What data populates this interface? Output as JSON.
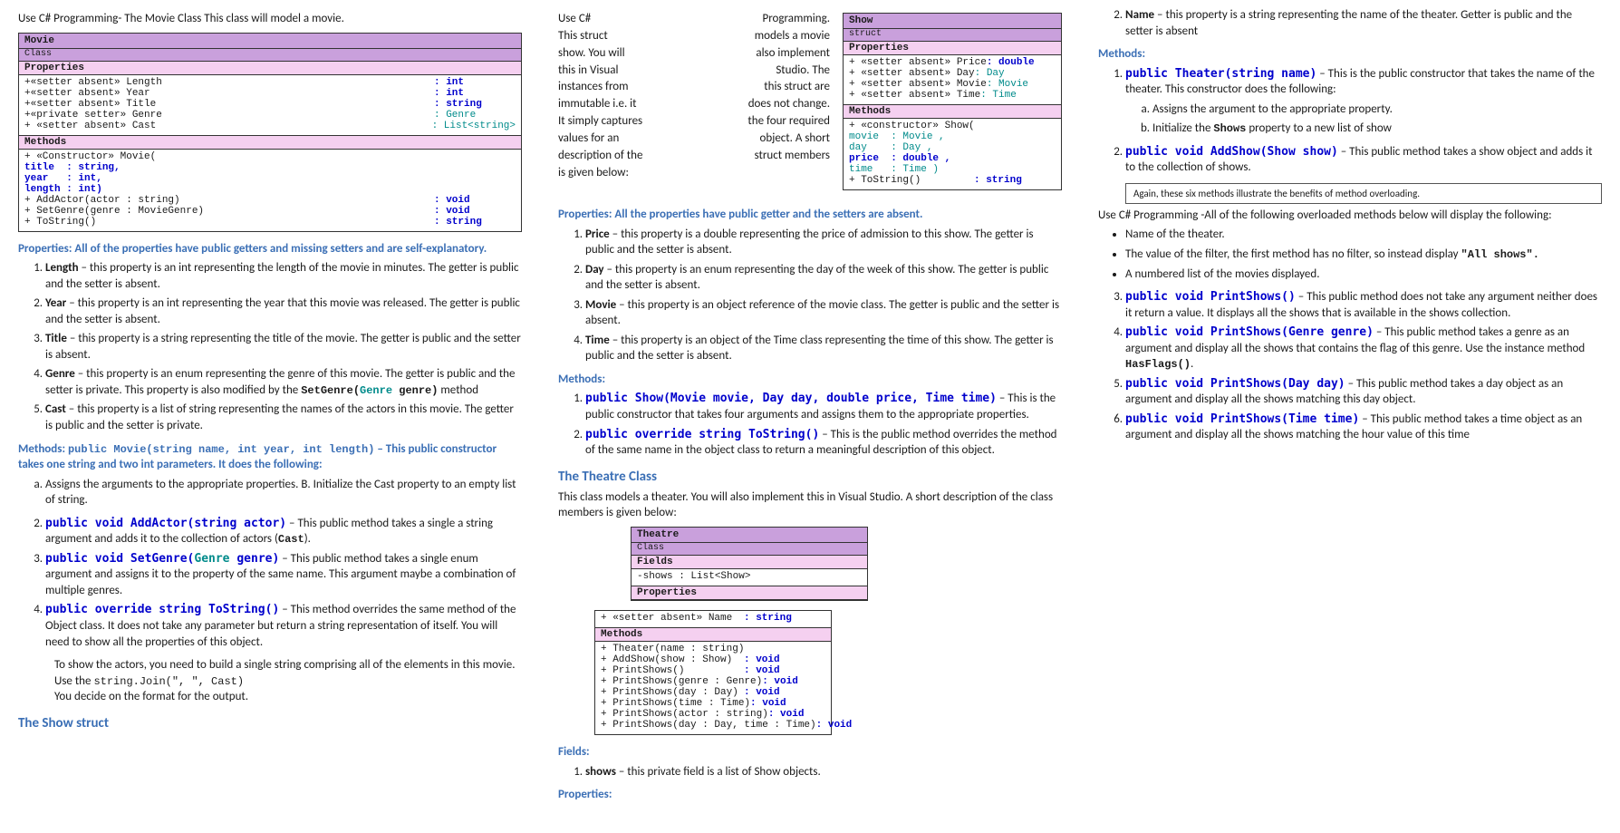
{
  "intro": "Use C# Programming- The Movie Class This class will model a movie.",
  "movie_uml": {
    "name": "Movie",
    "kind": "Class",
    "props": [
      {
        "l": "+«setter absent» Length",
        "r": ": int"
      },
      {
        "l": "+«setter absent» Year",
        "r": ": int"
      },
      {
        "l": "+«setter absent» Title",
        "r": ": string"
      },
      {
        "l": "+«private setter» Genre",
        "r": ": Genre"
      },
      {
        "l": "+ «setter absent» Cast",
        "r": "  : List<string>"
      }
    ],
    "methods": {
      "ctor_label": "+ «Constructor» Movie(",
      "ctor_args": [
        "title  : string,",
        "year   : int,",
        "length : int)"
      ],
      "rows": [
        {
          "l": "+ AddActor(actor : string)",
          "r": ": void"
        },
        {
          "l": "+ SetGenre(genre : MovieGenre)",
          "r": ": void"
        },
        {
          "l": "+ ToString()",
          "r": ": string"
        }
      ]
    }
  },
  "props_head": "Properties: All of the properties have public getters and missing setters and are self-explanatory.",
  "props_list": [
    {
      "name": "Length",
      "desc": " – this property is an int representing the length of the movie in minutes. The getter is public and the setter is absent."
    },
    {
      "name": "Year",
      "desc": " – this property is an int representing the year that this movie was released. The getter is public and the setter is absent."
    },
    {
      "name": "Title",
      "desc": " – this property is a string representing the title of the movie. The getter is public and the setter is absent."
    },
    {
      "name": "Genre",
      "desc": " – this property is an enum representing the genre of this movie. The getter is public and the setter is private. This property is also modified by the ",
      "tail": " method"
    },
    {
      "name": "Cast",
      "desc": " – this property is a list of string representing the names of the actors in this movie. The getter is public and the setter is private."
    }
  ],
  "genre_sig_pre": "SetGenre(",
  "genre_sig_type": "Genre",
  "genre_sig_post": " genre)",
  "methods_head_pre": "Methods: ",
  "methods_sig": "public Movie(string name, int year, int length)",
  "methods_head_post": " – This public constructor takes one string and two int  parameters. It does the following:",
  "methods_list": {
    "a": "Assigns the arguments to the appropriate properties. B. Initialize the Cast property to an empty list of string.",
    "addactor_sig": "public void AddActor(string actor)",
    "addactor_desc": " – This public method takes a single a string argument and adds it to the collection of actors (",
    "addactor_cast": "Cast",
    "addactor_end": ").",
    "setgenre_sig_pre": "public void SetGenre(",
    "setgenre_sig_type": "Genre",
    "setgenre_sig_post": " genre)",
    "setgenre_desc": " – This public method takes a single enum argument and assigns it to the property of the same name. This argument maybe a combination of multiple genres.",
    "tostring_sig": "public override string ToString()",
    "tostring_desc": " – This method overrides the same method of the Object class. It does not take any parameter but return a string representation of itself. You will need to show all the properties of this object."
  },
  "col2_top": {
    "p1": "To show the actors, you need to build a single string comprising all of the elements in this movie. Use the ",
    "code": "string.Join(\", \", Cast)",
    "p2": "You decide on the format for the output."
  },
  "show_head": "The Show struct",
  "show_text": {
    "l1": "Use C#",
    "l2": "This struct",
    "l3": "show. You will",
    "l4": "this in Visual",
    "l5": "instances from",
    "l6": "immutable i.e. it",
    "l7": "It simply captures",
    "l8": "values for an",
    "l9": "description of the",
    "l10": "is given below:",
    "r1": "Programming.",
    "r2": "models a movie",
    "r3": "also implement",
    "r4": "Studio. The",
    "r5": "this struct are",
    "r6": "does not change.",
    "r7": "the four required",
    "r8": "object. A short",
    "r9": "struct members"
  },
  "show_uml": {
    "name": "Show",
    "kind": "struct",
    "props": [
      {
        "l": "+ «setter absent» Price",
        "r": ": double"
      },
      {
        "l": "+ «setter absent» Day",
        "r": ": Day"
      },
      {
        "l": "+ «setter absent» Movie",
        "r": ": Movie"
      },
      {
        "l": "+ «setter absent» Time",
        "r": ": Time"
      }
    ],
    "ctor_label": "+ «constructor» Show(",
    "ctor_args": [
      "movie  : Movie ,",
      "day    : Day ,",
      "price  : double ,",
      "time   : Time )"
    ],
    "ts": {
      "l": "+ ToString()",
      "r": ": string"
    }
  },
  "show_props_head": "Properties: All the properties have public getter and the setters are absent.",
  "show_props": [
    {
      "name": "Price",
      "desc": " – this property is a double representing the price of admission to this show. The getter is public and the setter is absent."
    },
    {
      "name": "Day",
      "desc": " – this property is an enum representing the day of the week of this show. The getter is public and the setter is absent."
    },
    {
      "name": "Movie",
      "desc": " – this property is an object reference of the movie class. The getter is public and the setter is absent."
    },
    {
      "name": "Time",
      "desc": " – this property is an object of the Time class representing the time of this show. The getter is public and the setter is absent."
    }
  ],
  "show_methods_head": "Methods:",
  "show_m1_sig": "public Show(Movie movie, Day day, double price, Time time)",
  "show_m1_desc": " – This is the public constructor that takes four arguments and assigns them to the appropriate properties.",
  "show_m2_sig": "public override string ToString()",
  "show_m2_desc": " – This is the public method overrides the method of the same name in the object class to return a meaningful description of this object.",
  "theatre_head": "The Theatre Class",
  "theatre_intro": "This class models a theater. You will also implement this in Visual Studio. A short description of the class members is given below:",
  "theatre_uml": {
    "name": "Theatre",
    "kind": "Class",
    "fields": [
      {
        "l": "-shows : List<Show>",
        "r": ""
      }
    ],
    "prop_top": {
      "l": "+ «setter absent» Name",
      "r": ": string"
    },
    "methods": [
      {
        "l": "+ Theater(name : string)",
        "r": ""
      },
      {
        "l": "+ AddShow(show : Show)",
        "r": ": void"
      },
      {
        "l": "+ PrintShows()",
        "r": ": void"
      },
      {
        "l": "+ PrintShows(genre : Genre)",
        "r": ": void"
      },
      {
        "l": "+ PrintShows(day : Day)",
        "r": ": void"
      },
      {
        "l": "+ PrintShows(time : Time)",
        "r": ": void"
      },
      {
        "l": "+ PrintShows(actor : string)",
        "r": ": void"
      },
      {
        "l": "+ PrintShows(day : Day, time : Time)",
        "r": ": void"
      }
    ]
  },
  "fields_head": "Fields:",
  "fields_item_name": "shows",
  "fields_item_desc": " – this private field is a list of Show objects.",
  "props3_head": "Properties:",
  "props3_name": "Name",
  "props3_desc": " – this property is a string representing the name of the theater. Getter is public and the setter is absent",
  "methods3_head": "Methods:",
  "t_m1_sig": "public Theater(string name)",
  "t_m1_desc": " – This is the public constructor that takes the name of the theater. This constructor does the following:",
  "t_m1_a": "Assigns the argument to the appropriate property.",
  "t_m1_b_pre": "Initialize the ",
  "t_m1_b_code": "Shows",
  "t_m1_b_post": " property to a new list of show",
  "t_m2_sig": "public void AddShow(Show show)",
  "t_m2_desc": " – This public method takes a show object and adds it to the collection of shows.",
  "note": "Again, these six methods illustrate the benefits of method overloading.",
  "overload_intro": "Use C# Programming -All of the following overloaded methods below will display the following:",
  "bullets": [
    "Name of the theater.",
    "The value of the filter, the first method has no filter, so instead display ",
    "A numbered list of the movies displayed."
  ],
  "bullet_code": "\"All shows\".",
  "t_m3_sig": "public void PrintShows()",
  "t_m3_desc": " – This public method does not take any argument neither does it return a value. It displays all the shows that is available in the shows collection.",
  "t_m4_sig": "public void PrintShows(Genre genre)",
  "t_m4_desc": " – This public method takes a genre as an argument and display all the shows that contains the flag of this genre. Use the instance method ",
  "t_m4_code": "HasFlags()",
  "t_m5_sig": "public void PrintShows(Day day)",
  "t_m5_desc": " – This public method takes a day object as an argument and display all the shows matching this day object.",
  "t_m6_sig": "public void PrintShows(Time time)",
  "t_m6_desc": " – This public method takes a time object as an argument and display all the shows matching the hour value of this time"
}
